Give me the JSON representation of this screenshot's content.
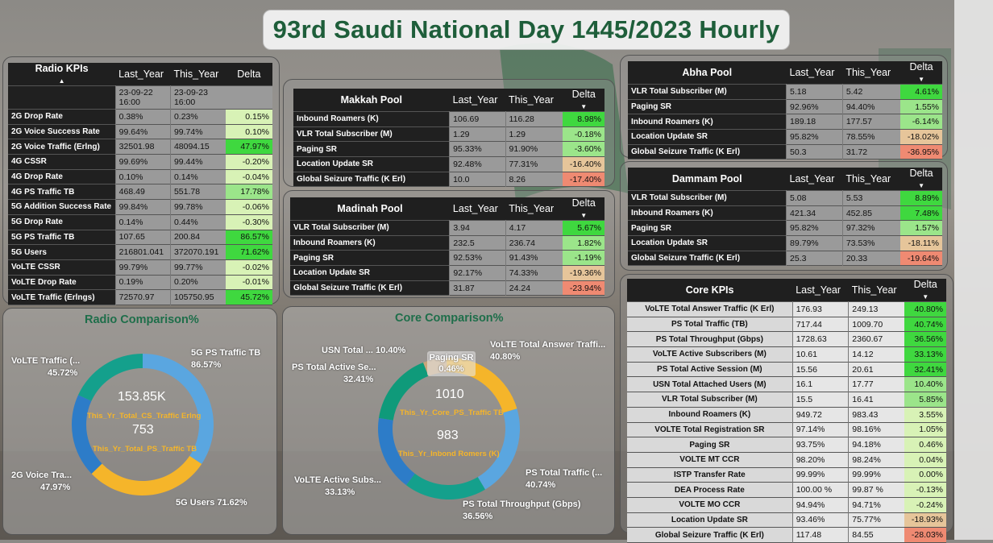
{
  "title": "93rd Saudi National Day 1445/2023 Hourly",
  "colors": {
    "title_text": "#1e5e3a",
    "delta_pos_strong": "#3fd83f",
    "delta_pos_mid": "#9be58a",
    "delta_pos_light": "#d8f2b6",
    "delta_neg_light": "#e6c59a",
    "delta_neg_strong": "#ef8a72",
    "donut_teal": "#14a08c",
    "donut_blue": "#5aa6e0",
    "donut_yellow": "#f5b52a",
    "donut_darkblue": "#2d7cc8",
    "donut_darkgreen": "#0f7a5c",
    "donut_tan": "#c8a57a"
  },
  "radio_kpis": {
    "headers": [
      "Radio KPIs",
      "Last_Year",
      "This_Year",
      "Delta"
    ],
    "date_last": "23-09-22 16:00",
    "date_this": "23-09-23 16:00",
    "rows": [
      {
        "name": "2G Drop Rate",
        "last": "0.38%",
        "this": "0.23%",
        "delta": "0.15%",
        "tone": "light"
      },
      {
        "name": "2G Voice Success Rate",
        "last": "99.64%",
        "this": "99.74%",
        "delta": "0.10%",
        "tone": "light"
      },
      {
        "name": "2G Voice Traffic (Erlng)",
        "last": "32501.98",
        "this": "48094.15",
        "delta": "47.97%",
        "tone": "strong"
      },
      {
        "name": "4G CSSR",
        "last": "99.69%",
        "this": "99.44%",
        "delta": "-0.20%",
        "tone": "light"
      },
      {
        "name": "4G Drop Rate",
        "last": "0.10%",
        "this": "0.14%",
        "delta": "-0.04%",
        "tone": "light"
      },
      {
        "name": "4G PS Traffic TB",
        "last": "468.49",
        "this": "551.78",
        "delta": "17.78%",
        "tone": "mid"
      },
      {
        "name": "5G Addition Success Rate",
        "last": "99.84%",
        "this": "99.78%",
        "delta": "-0.06%",
        "tone": "light"
      },
      {
        "name": "5G Drop Rate",
        "last": "0.14%",
        "this": "0.44%",
        "delta": "-0.30%",
        "tone": "light"
      },
      {
        "name": "5G PS Traffic TB",
        "last": "107.65",
        "this": "200.84",
        "delta": "86.57%",
        "tone": "strong"
      },
      {
        "name": "5G Users",
        "last": "216801.041",
        "this": "372070.191",
        "delta": "71.62%",
        "tone": "strong"
      },
      {
        "name": "VoLTE CSSR",
        "last": "99.79%",
        "this": "99.77%",
        "delta": "-0.02%",
        "tone": "light"
      },
      {
        "name": "VoLTE Drop Rate",
        "last": "0.19%",
        "this": "0.20%",
        "delta": "-0.01%",
        "tone": "light"
      },
      {
        "name": "VoLTE Traffic (Erlngs)",
        "last": "72570.97",
        "this": "105750.95",
        "delta": "45.72%",
        "tone": "strong"
      }
    ]
  },
  "makkah_pool": {
    "headers": [
      "Makkah Pool",
      "Last_Year",
      "This_Year",
      "Delta"
    ],
    "rows": [
      {
        "name": "Inbound Roamers (K)",
        "last": "106.69",
        "this": "116.28",
        "delta": "8.98%",
        "tone": "strong"
      },
      {
        "name": "VLR Total Subscriber (M)",
        "last": "1.29",
        "this": "1.29",
        "delta": "-0.18%",
        "tone": "mid"
      },
      {
        "name": "Paging SR",
        "last": "95.33%",
        "this": "91.90%",
        "delta": "-3.60%",
        "tone": "mid"
      },
      {
        "name": "Location Update SR",
        "last": "92.48%",
        "this": "77.31%",
        "delta": "-16.40%",
        "tone": "neg_light"
      },
      {
        "name": "Global Seizure Traffic (K Erl)",
        "last": "10.0",
        "this": "8.26",
        "delta": "-17.40%",
        "tone": "neg_strong"
      }
    ]
  },
  "madinah_pool": {
    "headers": [
      "Madinah Pool",
      "Last_Year",
      "This_Year",
      "Delta"
    ],
    "rows": [
      {
        "name": "VLR Total Subscriber (M)",
        "last": "3.94",
        "this": "4.17",
        "delta": "5.67%",
        "tone": "strong"
      },
      {
        "name": "Inbound Roamers (K)",
        "last": "232.5",
        "this": "236.74",
        "delta": "1.82%",
        "tone": "mid"
      },
      {
        "name": "Paging SR",
        "last": "92.53%",
        "this": "91.43%",
        "delta": "-1.19%",
        "tone": "mid"
      },
      {
        "name": "Location Update SR",
        "last": "92.17%",
        "this": "74.33%",
        "delta": "-19.36%",
        "tone": "neg_light"
      },
      {
        "name": "Global Seizure Traffic (K Erl)",
        "last": "31.87",
        "this": "24.24",
        "delta": "-23.94%",
        "tone": "neg_strong"
      }
    ]
  },
  "abha_pool": {
    "headers": [
      "Abha Pool",
      "Last_Year",
      "This_Year",
      "Delta"
    ],
    "rows": [
      {
        "name": "VLR Total Subscriber (M)",
        "last": "5.18",
        "this": "5.42",
        "delta": "4.61%",
        "tone": "strong"
      },
      {
        "name": "Paging SR",
        "last": "92.96%",
        "this": "94.40%",
        "delta": "1.55%",
        "tone": "mid"
      },
      {
        "name": "Inbound Roamers (K)",
        "last": "189.18",
        "this": "177.57",
        "delta": "-6.14%",
        "tone": "mid"
      },
      {
        "name": "Location Update SR",
        "last": "95.82%",
        "this": "78.55%",
        "delta": "-18.02%",
        "tone": "neg_light"
      },
      {
        "name": "Global Seizure Traffic (K Erl)",
        "last": "50.3",
        "this": "31.72",
        "delta": "-36.95%",
        "tone": "neg_strong"
      }
    ]
  },
  "dammam_pool": {
    "headers": [
      "Dammam Pool",
      "Last_Year",
      "This_Year",
      "Delta"
    ],
    "rows": [
      {
        "name": "VLR Total Subscriber (M)",
        "last": "5.08",
        "this": "5.53",
        "delta": "8.89%",
        "tone": "strong"
      },
      {
        "name": "Inbound Roamers (K)",
        "last": "421.34",
        "this": "452.85",
        "delta": "7.48%",
        "tone": "strong"
      },
      {
        "name": "Paging SR",
        "last": "95.82%",
        "this": "97.32%",
        "delta": "1.57%",
        "tone": "mid"
      },
      {
        "name": "Location Update SR",
        "last": "89.79%",
        "this": "73.53%",
        "delta": "-18.11%",
        "tone": "neg_light"
      },
      {
        "name": "Global Seizure Traffic (K Erl)",
        "last": "25.3",
        "this": "20.33",
        "delta": "-19.64%",
        "tone": "neg_strong"
      }
    ]
  },
  "core_kpis": {
    "headers": [
      "Core KPIs",
      "Last_Year",
      "This_Year",
      "Delta"
    ],
    "rows": [
      {
        "name": "VoLTE Total Answer Traffic (K Erl)",
        "last": "176.93",
        "this": "249.13",
        "delta": "40.80%",
        "tone": "strong"
      },
      {
        "name": "PS Total Traffic (TB)",
        "last": "717.44",
        "this": "1009.70",
        "delta": "40.74%",
        "tone": "strong"
      },
      {
        "name": "PS Total Throughput (Gbps)",
        "last": "1728.63",
        "this": "2360.67",
        "delta": "36.56%",
        "tone": "strong"
      },
      {
        "name": "VoLTE Active Subscribers (M)",
        "last": "10.61",
        "this": "14.12",
        "delta": "33.13%",
        "tone": "strong"
      },
      {
        "name": "PS Total Active Session (M)",
        "last": "15.56",
        "this": "20.61",
        "delta": "32.41%",
        "tone": "strong"
      },
      {
        "name": "USN Total Attached Users (M)",
        "last": "16.1",
        "this": "17.77",
        "delta": "10.40%",
        "tone": "mid"
      },
      {
        "name": "VLR Total Subscriber (M)",
        "last": "15.5",
        "this": "16.41",
        "delta": "5.85%",
        "tone": "mid"
      },
      {
        "name": "Inbound Roamers (K)",
        "last": "949.72",
        "this": "983.43",
        "delta": "3.55%",
        "tone": "light"
      },
      {
        "name": "VOLTE Total Registration SR",
        "last": "97.14%",
        "this": "98.16%",
        "delta": "1.05%",
        "tone": "light"
      },
      {
        "name": "Paging SR",
        "last": "93.75%",
        "this": "94.18%",
        "delta": "0.46%",
        "tone": "light"
      },
      {
        "name": "VOLTE MT CCR",
        "last": "98.20%",
        "this": "98.24%",
        "delta": "0.04%",
        "tone": "light"
      },
      {
        "name": "ISTP Transfer Rate",
        "last": "99.99%",
        "this": "99.99%",
        "delta": "0.00%",
        "tone": "light"
      },
      {
        "name": "DEA Process Rate",
        "last": "100.00 %",
        "this": "99.87 %",
        "delta": "-0.13%",
        "tone": "light"
      },
      {
        "name": "VOLTE MO CCR",
        "last": "94.94%",
        "this": "94.71%",
        "delta": "-0.24%",
        "tone": "light"
      },
      {
        "name": "Location Update SR",
        "last": "93.46%",
        "this": "75.77%",
        "delta": "-18.93%",
        "tone": "neg_light"
      },
      {
        "name": "Global Seizure Traffic (K Erl)",
        "last": "117.48",
        "this": "84.55",
        "delta": "-28.03%",
        "tone": "neg_strong"
      }
    ]
  },
  "radio_comparison": {
    "title": "Radio Comparison%",
    "center_value_1": "153.85K",
    "center_label_1": "This_Yr_Total_CS_Traffic Erlng",
    "center_value_2": "753",
    "center_label_2": "This_Yr_Total_PS_Traffic TB",
    "segments": [
      {
        "name": "5G PS Traffic TB",
        "value": "86.57%",
        "pct": 86.57,
        "color": "#5aa6e0"
      },
      {
        "name": "5G Users",
        "value": "71.62%",
        "pct": 71.62,
        "color": "#f5b52a"
      },
      {
        "name": "2G Voice Tra...",
        "value": "47.97%",
        "pct": 47.97,
        "color": "#2d7cc8"
      },
      {
        "name": "VoLTE Traffic (...",
        "value": "45.72%",
        "pct": 45.72,
        "color": "#14a08c"
      }
    ]
  },
  "core_comparison": {
    "title": "Core Comparison%",
    "center_value_1": "1010",
    "center_label_1": "This_Yr_Core_PS_Traffic TB",
    "center_value_2": "983",
    "center_label_2": "This_Yr_Inbond Romers (K)",
    "tooltip_label": "Paging SR",
    "tooltip_value": "0.46%",
    "segments": [
      {
        "name": "VoLTE Total Answer Traffi...",
        "value": "40.80%",
        "pct": 40.8,
        "color": "#f5b52a"
      },
      {
        "name": "PS Total Traffic (...",
        "value": "40.74%",
        "pct": 40.74,
        "color": "#5aa6e0"
      },
      {
        "name": "PS Total Throughput (Gbps)",
        "value": "36.56%",
        "pct": 36.56,
        "color": "#14a08c"
      },
      {
        "name": "VoLTE Active Subs...",
        "value": "33.13%",
        "pct": 33.13,
        "color": "#2d7cc8"
      },
      {
        "name": "PS Total Active Se...",
        "value": "32.41%",
        "pct": 32.41,
        "color": "#0f9a7a"
      },
      {
        "name": "USN Total ...",
        "value": "10.40%",
        "pct": 10.4,
        "color": "#c8a57a"
      }
    ]
  }
}
